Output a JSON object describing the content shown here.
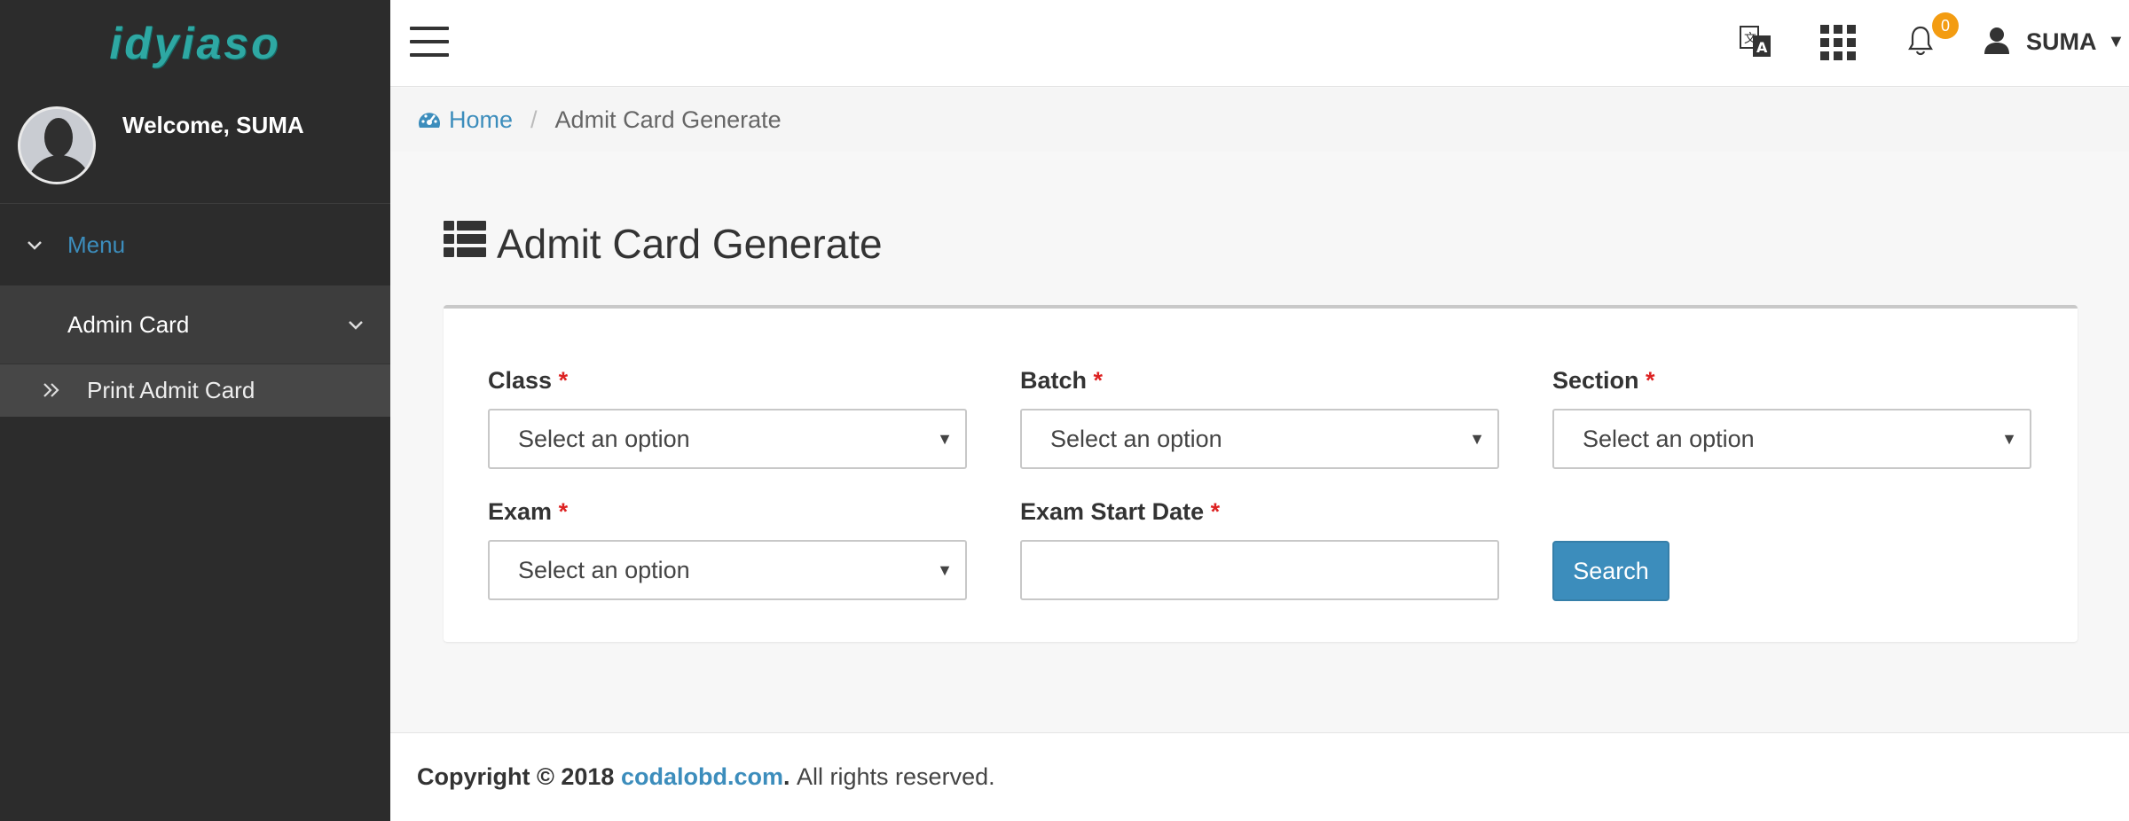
{
  "app": {
    "logo": "idyiaso"
  },
  "sidebar": {
    "welcome": "Welcome, SUMA",
    "menu_label": "Menu",
    "items": [
      {
        "label": "Admin Card",
        "icon": "chevron-down-icon"
      }
    ],
    "sub_items": [
      {
        "label": "Print Admit Card",
        "icon": "double-chevron-right-icon"
      }
    ]
  },
  "header": {
    "notification_count": "0",
    "user_name": "SUMA"
  },
  "breadcrumb": {
    "home": "Home",
    "current": "Admit Card Generate"
  },
  "page": {
    "title": "Admit Card Generate"
  },
  "form": {
    "class": {
      "label": "Class",
      "required": "*",
      "value": "Select an option"
    },
    "batch": {
      "label": "Batch",
      "required": "*",
      "value": "Select an option"
    },
    "section": {
      "label": "Section",
      "required": "*",
      "value": "Select an option"
    },
    "exam": {
      "label": "Exam",
      "required": "*",
      "value": "Select an option"
    },
    "exam_start_date": {
      "label": "Exam Start Date",
      "required": "*",
      "value": ""
    },
    "search_button": "Search"
  },
  "footer": {
    "prefix": "Copyright © 2018",
    "link": "codalobd.com",
    "suffix": ". All rights reserved."
  },
  "colors": {
    "sidebar_bg": "#2c2c2c",
    "accent": "#3c8dbc",
    "badge": "#f39c12",
    "required": "#dd2222"
  }
}
